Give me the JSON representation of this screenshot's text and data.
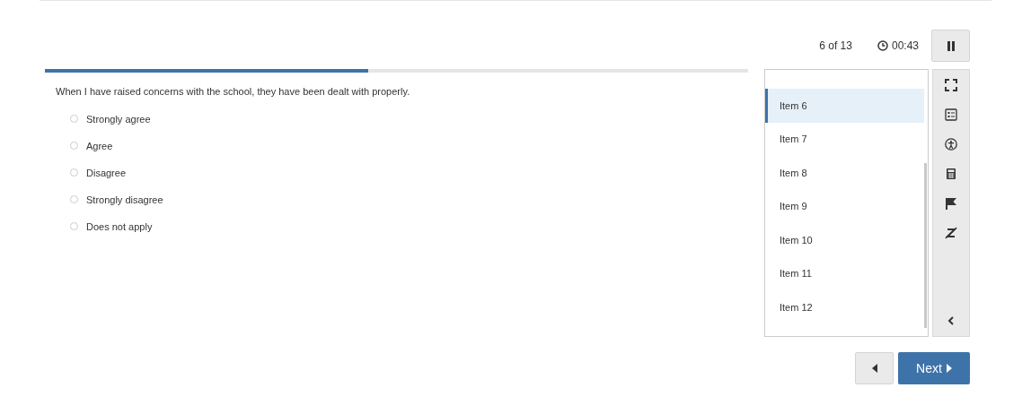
{
  "header": {
    "position": "6 of 13",
    "timer": "00:43"
  },
  "progress": {
    "level": 0.46
  },
  "question": {
    "text": "When I have raised concerns with the school, they have been dealt with properly.",
    "options": [
      {
        "label": "Strongly agree",
        "selected": false
      },
      {
        "label": "Agree",
        "selected": false
      },
      {
        "label": "Disagree",
        "selected": false
      },
      {
        "label": "Strongly disagree",
        "selected": false
      },
      {
        "label": "Does not apply",
        "selected": false
      }
    ]
  },
  "item_list": [
    {
      "label": "Item 6",
      "selected": true
    },
    {
      "label": "Item 7",
      "selected": false
    },
    {
      "label": "Item 8",
      "selected": false
    },
    {
      "label": "Item 9",
      "selected": false
    },
    {
      "label": "Item 10",
      "selected": false
    },
    {
      "label": "Item 11",
      "selected": false
    },
    {
      "label": "Item 12",
      "selected": false
    }
  ],
  "navigation": {
    "next": "Next"
  }
}
